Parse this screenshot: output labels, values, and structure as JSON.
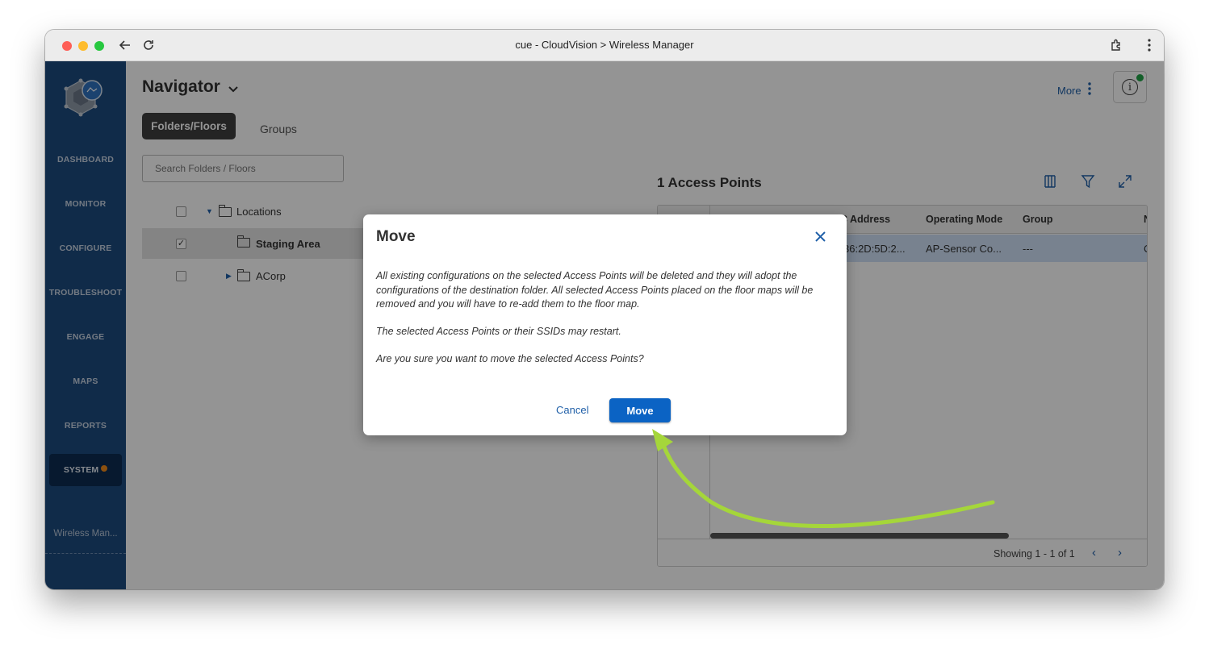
{
  "window": {
    "title": "cue - CloudVision > Wireless Manager"
  },
  "sidebar": {
    "items": [
      "DASHBOARD",
      "MONITOR",
      "CONFIGURE",
      "TROUBLESHOOT",
      "ENGAGE",
      "MAPS",
      "REPORTS"
    ],
    "system": "SYSTEM",
    "footer": "Wireless Man..."
  },
  "header": {
    "title": "Navigator",
    "more_label": "More"
  },
  "tabs": {
    "active": "Folders/Floors",
    "other": "Groups"
  },
  "search": {
    "placeholder": "Search Folders / Floors"
  },
  "tree": {
    "root": "Locations",
    "staging": "Staging Area",
    "acorp": "ACorp"
  },
  "access_points": {
    "title": "1 Access Points",
    "columns": [
      "C Address",
      "Operating Mode",
      "Group",
      "N"
    ],
    "row": [
      "36:2D:5D:2...",
      "AP-Sensor Co...",
      "---",
      "C"
    ],
    "showing": "Showing 1 - 1 of 1"
  },
  "modal": {
    "title": "Move",
    "p1": "All existing configurations on the selected Access Points will be deleted and they will adopt the configurations of the destination folder. All selected Access Points placed on the floor maps will be removed and you will have to re-add them to the floor map.",
    "p2": "The selected Access Points or their SSIDs may restart.",
    "p3": "Are you sure you want to move the selected Access Points?",
    "cancel": "Cancel",
    "confirm": "Move"
  },
  "colors": {
    "sidebar": "#1d4a7e",
    "accent": "#0b63c4",
    "arrow": "#a5d63a",
    "status_dot": "#22a447",
    "system_badge": "#f08a1a"
  },
  "icons": [
    "back-arrow-icon",
    "reload-icon",
    "extensions-icon",
    "kebab-icon",
    "info-icon",
    "columns-icon",
    "filter-icon",
    "expand-icon",
    "close-icon",
    "folder-icon",
    "chevron-down-icon"
  ]
}
